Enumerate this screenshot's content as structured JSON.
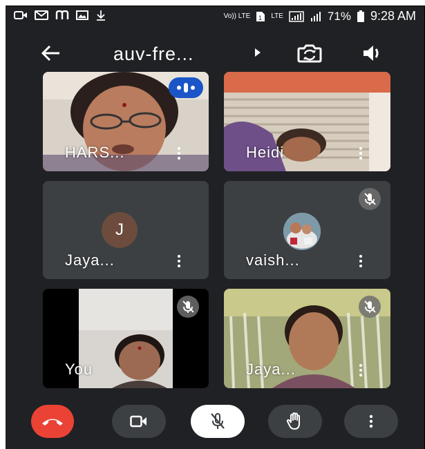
{
  "status_bar": {
    "network_labels": [
      "Vo)) LTE",
      "LTE"
    ],
    "battery": "71%",
    "time": "9:28 AM"
  },
  "app_bar": {
    "meeting_title": "auv-fre..."
  },
  "participants": [
    {
      "name": "HARS...",
      "state": "speaking"
    },
    {
      "name": "Heidi",
      "state": "video"
    },
    {
      "name": "Jaya...",
      "avatar_letter": "J",
      "state": "no-video"
    },
    {
      "name": "vaish...",
      "state": "muted"
    },
    {
      "name": "You",
      "state": "muted"
    },
    {
      "name": "Jaya...",
      "state": "muted"
    }
  ],
  "controls": {
    "icons": [
      "end-call-icon",
      "camera-icon",
      "mic-off-icon",
      "raise-hand-icon",
      "more-icon"
    ]
  },
  "colors": {
    "background": "#202124",
    "tile": "#3c4043",
    "end_call": "#ea4335",
    "speaking_badge": "#1a56c8"
  }
}
